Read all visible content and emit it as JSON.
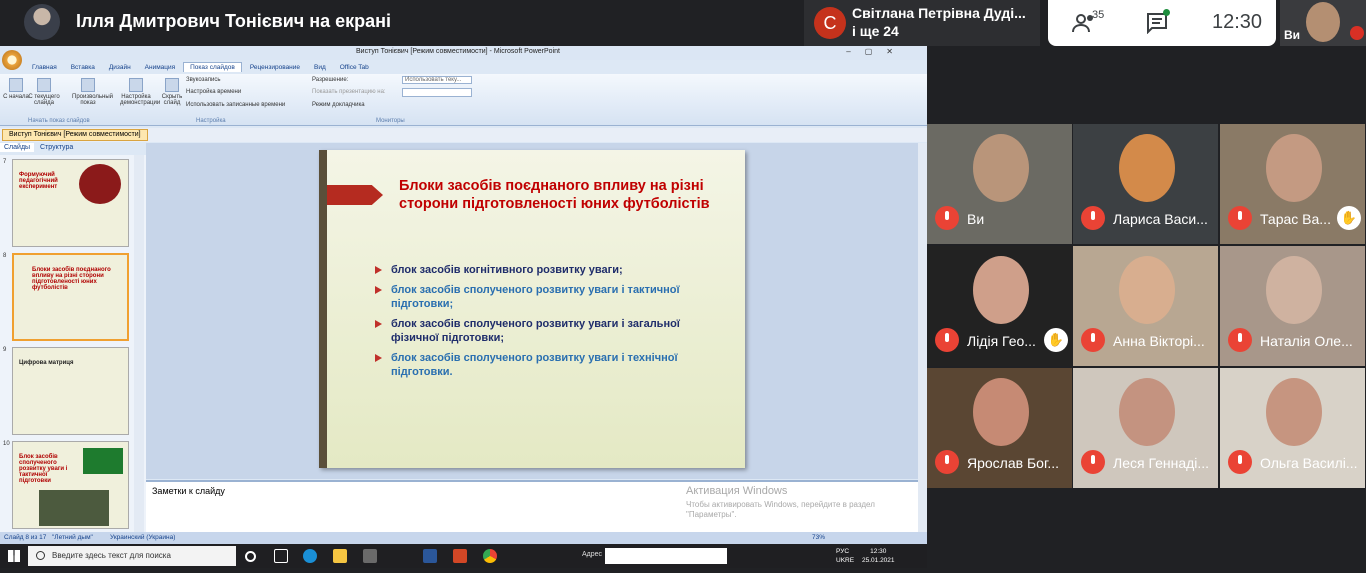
{
  "meet": {
    "presenter_title": "Ілля Дмитрович Тонієвич на екрані",
    "speaker_initial": "С",
    "speaker_name": "Світлана Петрівна Дуді...",
    "speaker_more": "і ще 24",
    "participants_count": "35",
    "clock": "12:30",
    "self_label": "Ви"
  },
  "ppt": {
    "window_title": "Виступ Тонієвич [Режим совместимости] - Microsoft PowerPoint",
    "tabs": [
      "Главная",
      "Вставка",
      "Дизайн",
      "Анимация",
      "Показ слайдов",
      "Рецензирование",
      "Вид",
      "Office Tab"
    ],
    "ribbon": {
      "btn1": "С начала",
      "btn2": "С текущего слайда",
      "btn3": "Произвольный показ",
      "btn4": "Настройка демонстрации",
      "btn5": "Скрыть слайд",
      "chk1": "Звукозапись",
      "chk2": "Настройка времени",
      "chk3": "Использовать записанные времени",
      "res_label": "Разрешение:",
      "res_value": "Использовать теку...",
      "show_on": "Показать презентацию на:",
      "presenter_mode": "Режим докладчика",
      "g1": "Начать показ слайдов",
      "g2": "Настройка",
      "g3": "Мониторы"
    },
    "doc_tab": "Виступ Тонієвич [Режим совместимости]",
    "panel_tabs": [
      "Слайды",
      "Структура"
    ],
    "thumbs": [
      {
        "num": "7",
        "title": "Формуючий педагогічний експеримент"
      },
      {
        "num": "8",
        "title": "Блоки засобів поєднаного впливу на різні сторони підготовленості юних футболістів"
      },
      {
        "num": "9",
        "title": "Цифрова матриця"
      },
      {
        "num": "10",
        "title": "Блок засобів сполученого розвитку уваги і тактичної підготовки"
      }
    ],
    "slide": {
      "title": "Блоки засобів поєднаного впливу на різні сторони підготовленості юних футболістів",
      "bullets": [
        "блок засобів когнітивного розвитку уваги;",
        "блок засобів сполученого розвитку уваги і тактичної підготовки;",
        "блок засобів сполученого розвитку уваги і загальної фізичної підготовки;",
        "блок засобів сполученого розвитку уваги і технічної підготовки."
      ]
    },
    "notes_label": "Заметки к слайду",
    "activation_title": "Активация Windows",
    "activation_sub": "Чтобы активировать Windows, перейдите в раздел \"Параметры\".",
    "status": {
      "slide": "Слайд 8 из 17",
      "theme": "\"Летний дым\"",
      "lang": "Украинский (Украина)",
      "zoom": "73%"
    }
  },
  "taskbar": {
    "search_placeholder": "Введите здесь текст для поиска",
    "addr_label": "Адрес",
    "lang": "РУС",
    "layout": "UKRE",
    "time": "12:30",
    "date": "25.01.2021"
  },
  "tiles": [
    {
      "name": "Ви",
      "face": "#b9957a",
      "bg": "#6b6a63",
      "hand": false
    },
    {
      "name": "Лариса Васи...",
      "face": "#d38a4a",
      "bg": "#3c4043",
      "hand": false
    },
    {
      "name": "Тарас Ва...",
      "face": "#c49a82",
      "bg": "#8a7a66",
      "hand": true
    },
    {
      "name": "Лідія Гео...",
      "face": "#cf9f8a",
      "bg": "#222",
      "hand": true
    },
    {
      "name": "Анна Вікторі...",
      "face": "#d8ae8f",
      "bg": "#b8a792",
      "hand": false
    },
    {
      "name": "Наталія Оле...",
      "face": "#cfb2a0",
      "bg": "#a8978a",
      "hand": false
    },
    {
      "name": "Ярослав Бог...",
      "face": "#c68a74",
      "bg": "#5a4633",
      "hand": false
    },
    {
      "name": "Леся Геннаді...",
      "face": "#c49380",
      "bg": "#cfc7bd",
      "hand": false
    },
    {
      "name": "Ольга Василі...",
      "face": "#c69580",
      "bg": "#d8d2c8",
      "hand": false
    }
  ]
}
